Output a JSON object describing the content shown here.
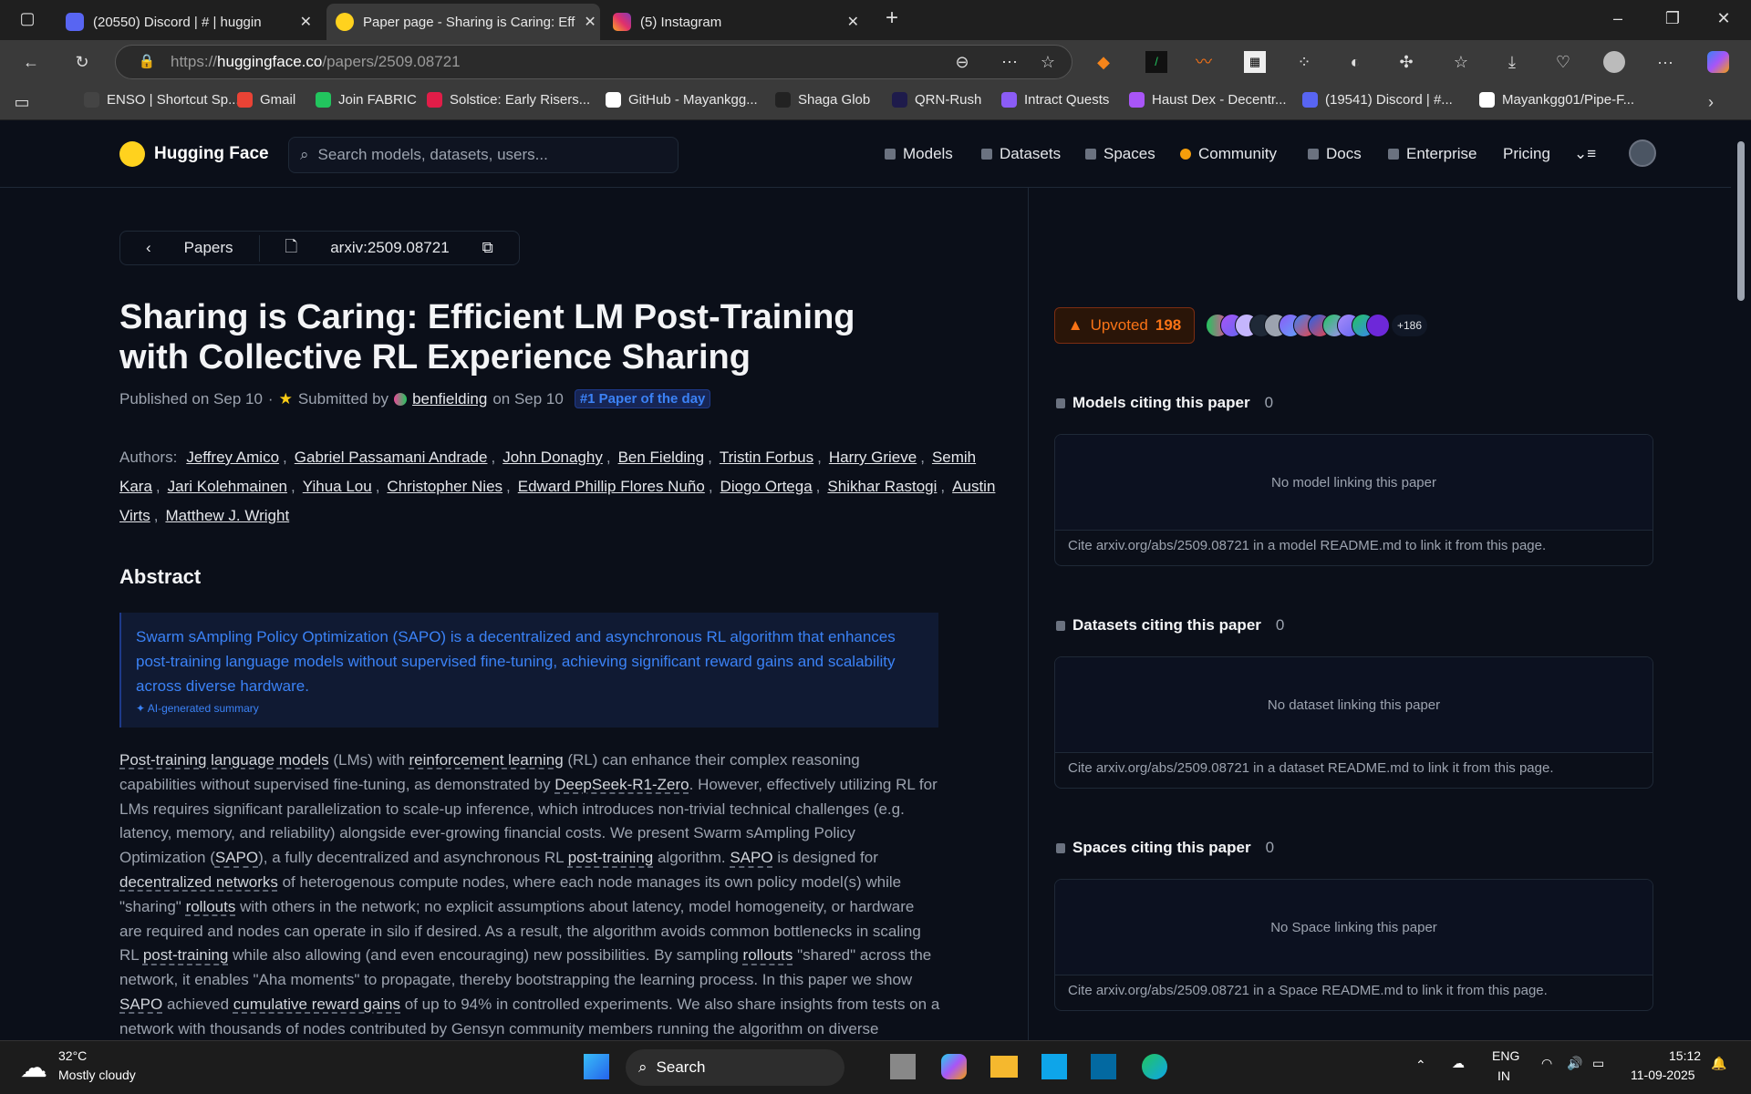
{
  "browser": {
    "tabs": [
      {
        "label": "(20550) Discord | # | huggin",
        "color": "#5865f2"
      },
      {
        "label": "Paper page - Sharing is Caring: Eff",
        "color": "#ffd21e"
      },
      {
        "label": "(5) Instagram",
        "color": "#e1306c"
      }
    ],
    "url_prefix": "https://",
    "url_host": "huggingface.co",
    "url_path": "/papers/2509.08721",
    "bookmarks": [
      {
        "label": "ENSO | Shortcut Sp...",
        "color": "#444"
      },
      {
        "label": "Gmail",
        "color": "#ea4335"
      },
      {
        "label": "Join FABRIC",
        "color": "#22c55e"
      },
      {
        "label": "Solstice: Early Risers...",
        "color": "#e11d48"
      },
      {
        "label": "GitHub - Mayankgg...",
        "color": "#fff"
      },
      {
        "label": "Shaga Glob",
        "color": "#222"
      },
      {
        "label": "QRN-Rush",
        "color": "#1e1b4b"
      },
      {
        "label": "Intract Quests",
        "color": "#8b5cf6"
      },
      {
        "label": "Haust Dex - Decentr...",
        "color": "#a855f7"
      },
      {
        "label": "(19541) Discord | #...",
        "color": "#5865f2"
      },
      {
        "label": "Mayankgg01/Pipe-F...",
        "color": "#fff"
      }
    ]
  },
  "header": {
    "brand": "Hugging Face",
    "search_placeholder": "Search models, datasets, users...",
    "nav": [
      "Models",
      "Datasets",
      "Spaces",
      "Community",
      "Docs",
      "Enterprise",
      "Pricing"
    ]
  },
  "crumb": {
    "back": "Papers",
    "arxiv": "arxiv:2509.08721"
  },
  "paper": {
    "title": "Sharing is Caring: Efficient LM Post-Training with Collective RL Experience Sharing",
    "published": "Published on Sep 10",
    "submitted_by": "Submitted by",
    "submitter": "benfielding",
    "submitted_on": "on Sep 10",
    "badge": "#1 Paper of the day",
    "authors_label": "Authors:",
    "authors": [
      "Jeffrey Amico",
      "Gabriel Passamani Andrade",
      "John Donaghy",
      "Ben Fielding",
      "Tristin Forbus",
      "Harry Grieve",
      "Semih Kara",
      "Jari Kolehmainen",
      "Yihua Lou",
      "Christopher Nies",
      "Edward Phillip Flores Nuño",
      "Diogo Ortega",
      "Shikhar Rastogi",
      "Austin Virts",
      "Matthew J. Wright"
    ],
    "abstract_heading": "Abstract",
    "summary": "Swarm sAmpling Policy Optimization (SAPO) is a decentralized and asynchronous RL algorithm that enhances post-training language models without supervised fine-tuning, achieving significant reward gains and scalability across diverse hardware.",
    "summary_note": "AI-generated summary",
    "abstract": [
      {
        "t": "Post-training language models",
        "u": true
      },
      {
        "t": " (LMs) with "
      },
      {
        "t": "reinforcement learning",
        "u": true
      },
      {
        "t": " (RL) can enhance their complex reasoning capabilities without supervised fine-tuning, as demonstrated by "
      },
      {
        "t": "DeepSeek-R1-Zero",
        "u": true
      },
      {
        "t": ". However, effectively utilizing RL for LMs requires significant parallelization to scale-up inference, which introduces non-trivial technical challenges (e.g. latency, memory, and reliability) alongside ever-growing financial costs. We present Swarm sAmpling Policy Optimization ("
      },
      {
        "t": "SAPO",
        "u": true
      },
      {
        "t": "), a fully decentralized and asynchronous RL "
      },
      {
        "t": "post-training",
        "u": true
      },
      {
        "t": " algorithm. "
      },
      {
        "t": "SAPO",
        "u": true
      },
      {
        "t": " is designed for "
      },
      {
        "t": "decentralized networks",
        "u": true
      },
      {
        "t": " of heterogenous compute nodes, where each node manages its own policy model(s) while \"sharing\" "
      },
      {
        "t": "rollouts",
        "u": true
      },
      {
        "t": " with others in the network; no explicit assumptions about latency, model homogeneity, or hardware are required and nodes can operate in silo if desired. As a result, the algorithm avoids common bottlenecks in scaling RL "
      },
      {
        "t": "post-training",
        "u": true
      },
      {
        "t": " while also allowing (and even encouraging) new possibilities. By sampling "
      },
      {
        "t": "rollouts",
        "u": true
      },
      {
        "t": " \"shared\" across the network, it enables \"Aha moments\" to propagate, thereby bootstrapping the learning process. In this paper we show "
      },
      {
        "t": "SAPO",
        "u": true
      },
      {
        "t": " achieved "
      },
      {
        "t": "cumulative reward gains",
        "u": true
      },
      {
        "t": " of up to 94% in controlled experiments. We also share insights from tests on a network with thousands of nodes contributed by Gensyn community members running the algorithm on diverse hardware and models during an"
      }
    ]
  },
  "sidebar": {
    "upvote_label": "Upvoted",
    "upvotes": "198",
    "more_upvoters": "+186",
    "sections": [
      {
        "title": "Models citing this paper",
        "count": "0",
        "empty": "No model linking this paper",
        "cite": "Cite arxiv.org/abs/2509.08721 in a model README.md to link it from this page."
      },
      {
        "title": "Datasets citing this paper",
        "count": "0",
        "empty": "No dataset linking this paper",
        "cite": "Cite arxiv.org/abs/2509.08721 in a dataset README.md to link it from this page."
      },
      {
        "title": "Spaces citing this paper",
        "count": "0",
        "empty": "No Space linking this paper",
        "cite": "Cite arxiv.org/abs/2509.08721 in a Space README.md to link it from this page."
      }
    ]
  },
  "taskbar": {
    "temp": "32°C",
    "weather": "Mostly cloudy",
    "search": "Search",
    "lang1": "ENG",
    "lang2": "IN",
    "time": "15:12",
    "date": "11-09-2025"
  }
}
